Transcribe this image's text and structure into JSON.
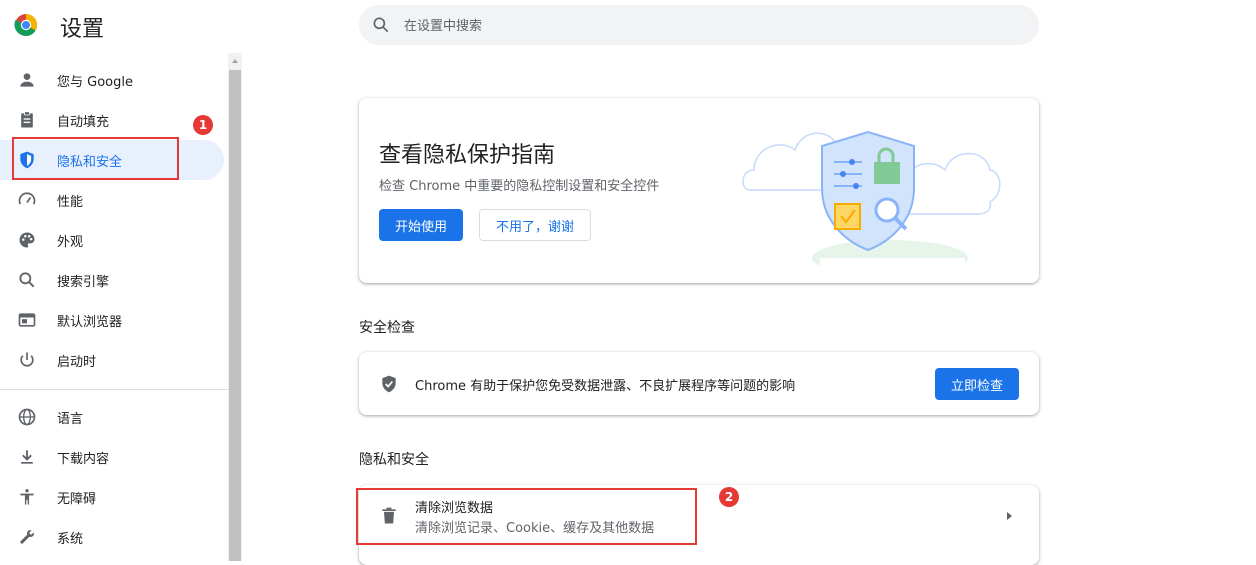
{
  "header": {
    "app_title": "设置",
    "search_placeholder": "在设置中搜索"
  },
  "sidebar": {
    "items": [
      {
        "label": "您与 Google",
        "icon": "person-icon"
      },
      {
        "label": "自动填充",
        "icon": "clipboard-icon"
      },
      {
        "label": "隐私和安全",
        "icon": "shield-icon",
        "active": true
      },
      {
        "label": "性能",
        "icon": "speedometer-icon"
      },
      {
        "label": "外观",
        "icon": "palette-icon"
      },
      {
        "label": "搜索引擎",
        "icon": "search-icon"
      },
      {
        "label": "默认浏览器",
        "icon": "browser-window-icon"
      },
      {
        "label": "启动时",
        "icon": "power-icon"
      },
      {
        "label": "语言",
        "icon": "globe-icon"
      },
      {
        "label": "下载内容",
        "icon": "download-icon"
      },
      {
        "label": "无障碍",
        "icon": "accessibility-icon"
      },
      {
        "label": "系统",
        "icon": "wrench-icon"
      }
    ]
  },
  "annotations": {
    "badge1": "1",
    "badge2": "2"
  },
  "promo": {
    "title": "查看隐私保护指南",
    "description": "检查 Chrome 中重要的隐私控制设置和安全控件",
    "start_button": "开始使用",
    "dismiss_button": "不用了，谢谢"
  },
  "safety_check": {
    "heading": "安全检查",
    "text": "Chrome 有助于保护您免受数据泄露、不良扩展程序等问题的影响",
    "button": "立即检查"
  },
  "privacy_section": {
    "heading": "隐私和安全",
    "clear_data": {
      "title": "清除浏览数据",
      "subtitle": "清除浏览记录、Cookie、缓存及其他数据"
    }
  },
  "colors": {
    "accent": "#1a73e8",
    "active_bg": "#e8f0fe",
    "annotation_red": "#e53935"
  }
}
